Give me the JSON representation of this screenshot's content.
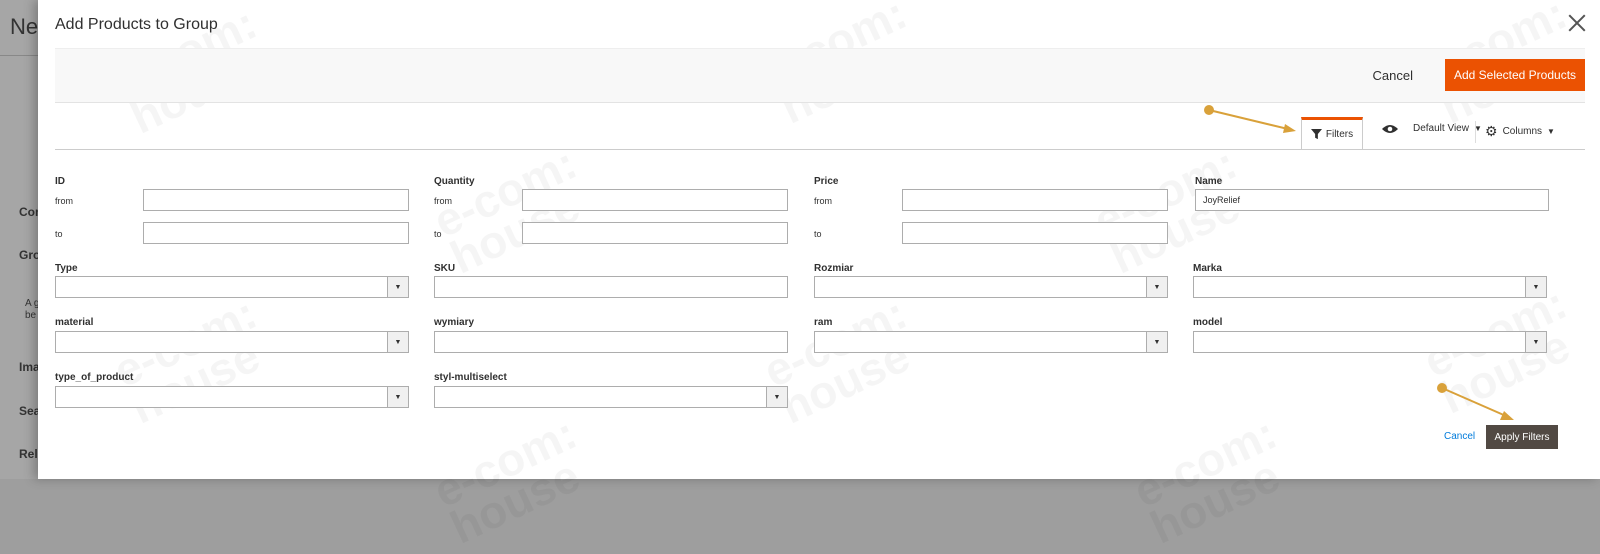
{
  "background": {
    "title": "New",
    "items": [
      "Con",
      "Gro",
      "Ima",
      "Sea",
      "Rela"
    ],
    "small_text": [
      "A g",
      "be"
    ]
  },
  "modal": {
    "title": "Add Products to Group",
    "cancel": "Cancel",
    "add_selected": "Add Selected Products",
    "toolbar": {
      "filters": "Filters",
      "default_view": "Default View",
      "columns": "Columns"
    },
    "filters": {
      "id": {
        "label": "ID",
        "from": "from",
        "to": "to"
      },
      "quantity": {
        "label": "Quantity",
        "from": "from",
        "to": "to"
      },
      "price": {
        "label": "Price",
        "from": "from",
        "to": "to"
      },
      "name": {
        "label": "Name",
        "value": "JoyRelief"
      },
      "type": {
        "label": "Type"
      },
      "sku": {
        "label": "SKU"
      },
      "rozmiar": {
        "label": "Rozmiar"
      },
      "marka": {
        "label": "Marka"
      },
      "material": {
        "label": "material"
      },
      "wymiary": {
        "label": "wymiary"
      },
      "ram": {
        "label": "ram"
      },
      "model": {
        "label": "model"
      },
      "type_of_product": {
        "label": "type_of_product"
      },
      "styl_multiselect": {
        "label": "styl-multiselect"
      }
    },
    "cancel_filters": "Cancel",
    "apply_filters": "Apply Filters"
  },
  "colors": {
    "accent": "#eb5202",
    "apply_button": "#514943",
    "link": "#007bdb",
    "annotation_arrow": "#d9a13a"
  },
  "watermark_text": "e-com:\nhouse"
}
